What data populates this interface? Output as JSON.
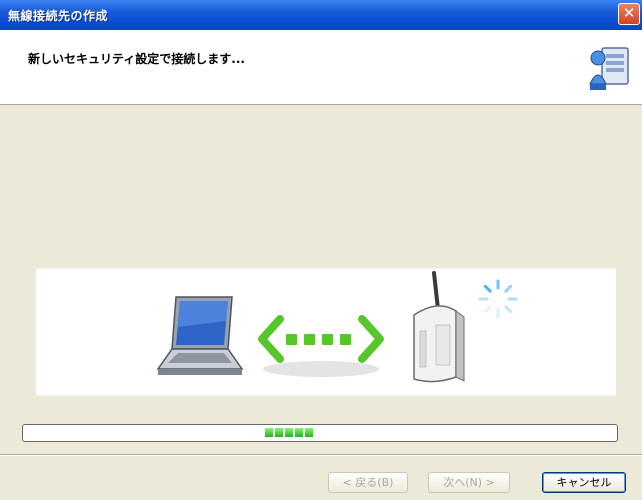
{
  "window": {
    "title": "無線接続先の作成",
    "close_label": "✕"
  },
  "header": {
    "message": "新しいセキュリティ設定で接続します..."
  },
  "progress": {
    "fraction": 0.08
  },
  "buttons": {
    "back_label": "< 戻る(B)",
    "next_label": "次へ(N) >",
    "cancel_label": "キャンセル"
  },
  "colors": {
    "titlebar": "#0a4fd6",
    "progress_fill": "#23b21c",
    "arrow_green": "#57c62b",
    "spinner_blue": "#6ec6ff"
  }
}
